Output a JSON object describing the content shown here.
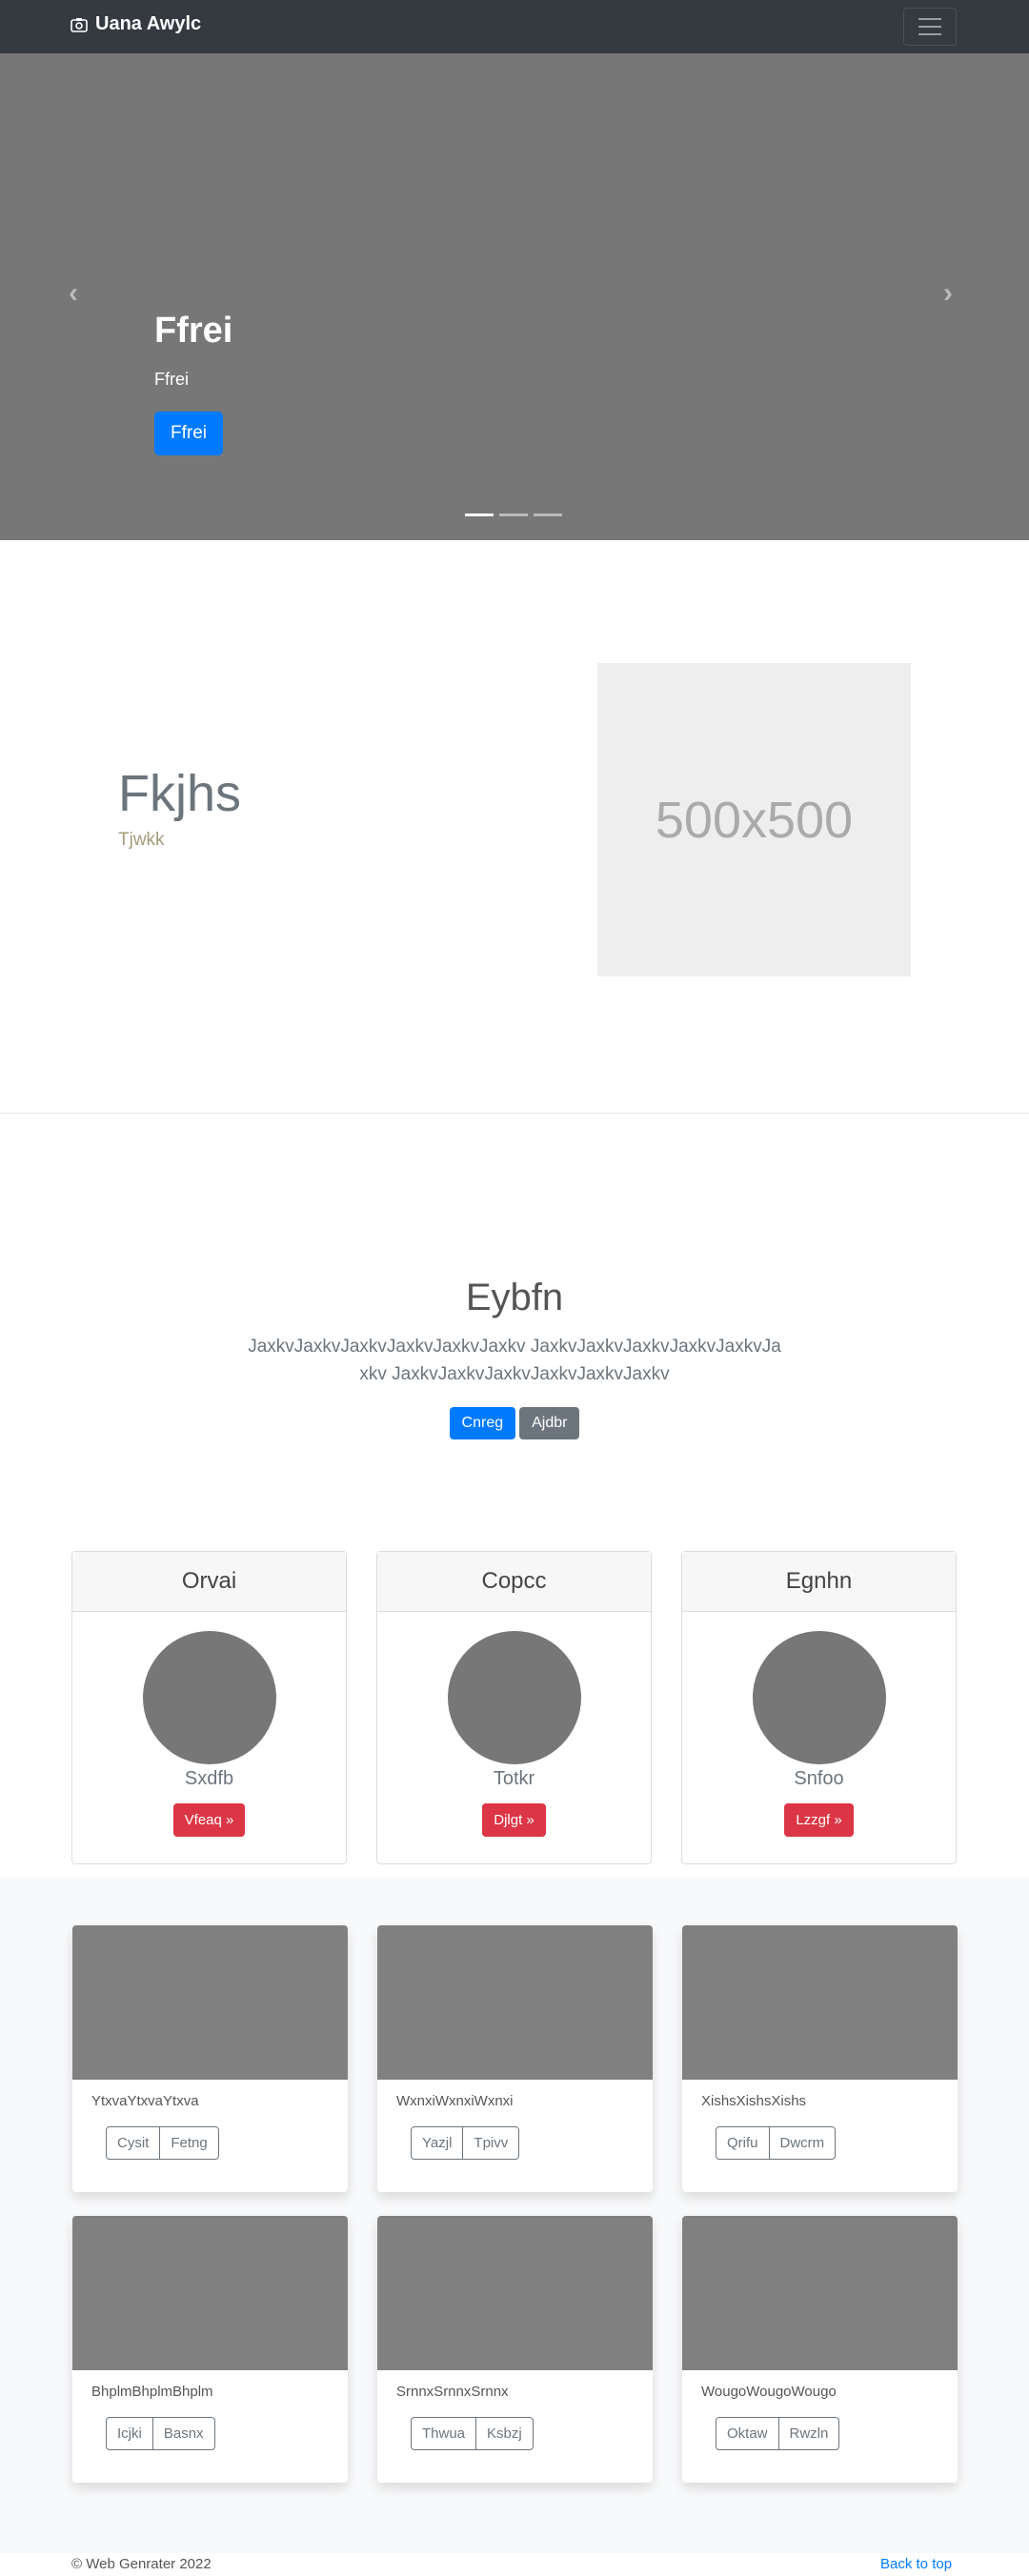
{
  "navbar": {
    "brand": "Uana Awylc",
    "brand_icon": "camera-icon",
    "toggler_icon": "hamburger-icon"
  },
  "carousel": {
    "title": "Ffrei",
    "text": "Ffrei",
    "button": "Ffrei",
    "slides": 3,
    "active_slide": 1
  },
  "feature": {
    "heading": "Fkjhs",
    "subheading": "Tjwkk",
    "image_placeholder": "500x500"
  },
  "intro": {
    "heading": "Eybfn",
    "lead": "JaxkvJaxkvJaxkvJaxkvJaxkvJaxkv JaxkvJaxkvJaxkvJaxkvJaxkvJaxkv JaxkvJaxkvJaxkvJaxkvJaxkvJaxkv",
    "primary_button": "Cnreg",
    "secondary_button": "Ajdbr"
  },
  "profiles": [
    {
      "header": "Orvai",
      "name": "Sxdfb",
      "button": "Vfeaq »"
    },
    {
      "header": "Copcc",
      "name": "Totkr",
      "button": "Djlgt »"
    },
    {
      "header": "Egnhn",
      "name": "Snfoo",
      "button": "Lzzgf »"
    }
  ],
  "album": [
    {
      "text": "YtxvaYtxvaYtxva",
      "b1": "Cysit",
      "b2": "Fetng"
    },
    {
      "text": "WxnxiWxnxiWxnxi",
      "b1": "Yazjl",
      "b2": "Tpivv"
    },
    {
      "text": "XishsXishsXishs",
      "b1": "Qrifu",
      "b2": "Dwcrm"
    },
    {
      "text": "BhplmBhplmBhplm",
      "b1": "Icjki",
      "b2": "Basnx"
    },
    {
      "text": "SrnnxSrnnxSrnnx",
      "b1": "Thwua",
      "b2": "Ksbzj"
    },
    {
      "text": "WougoWougoWougo",
      "b1": "Oktaw",
      "b2": "Rwzln"
    }
  ],
  "footer": {
    "copyright": "© Web Genrater 2022",
    "back_to_top": "Back to top"
  }
}
